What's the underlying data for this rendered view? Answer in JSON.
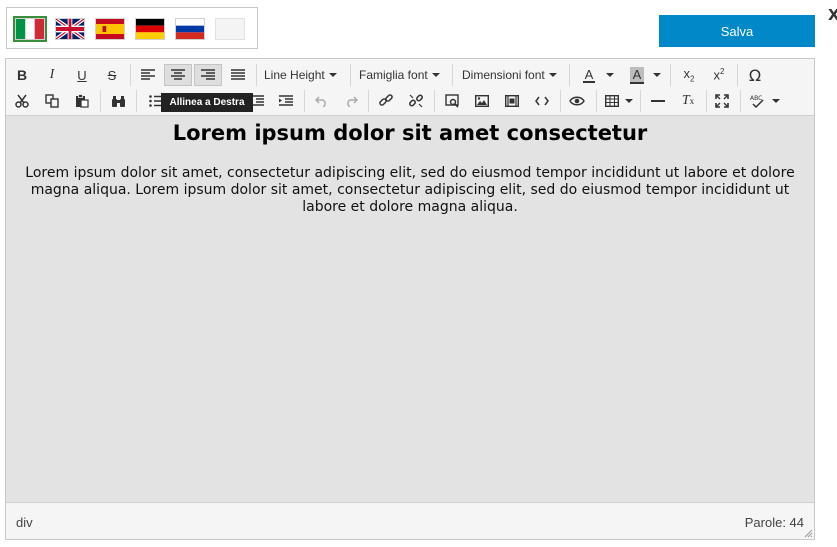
{
  "languages": [
    {
      "name": "italian",
      "selected": true
    },
    {
      "name": "english",
      "selected": false
    },
    {
      "name": "spanish",
      "selected": false
    },
    {
      "name": "german",
      "selected": false
    },
    {
      "name": "russian",
      "selected": false
    },
    {
      "name": "empty",
      "selected": false
    }
  ],
  "actions": {
    "save_label": "Salva",
    "close_label": "X"
  },
  "toolbar": {
    "line_height_label": "Line Height",
    "font_family_label": "Famiglia font",
    "font_size_label": "Dimensioni font",
    "font_color_glyph": "A",
    "bg_color_glyph": "A",
    "tooltip": "Allinea a Destra"
  },
  "content": {
    "heading": "Lorem ipsum dolor sit amet consectetur",
    "paragraph": "Lorem ipsum dolor sit amet, consectetur adipiscing elit, sed do eiusmod tempor incididunt ut labore et dolore magna aliqua. Lorem ipsum dolor sit amet, consectetur adipiscing elit, sed do eiusmod tempor incididunt ut labore et dolore magna aliqua."
  },
  "status": {
    "path": "div",
    "word_count": "Parole: 44"
  },
  "colors": {
    "save_button": "#0088c8",
    "editor_bg": "#e3e3e3",
    "toolbar_bg": "#f5f5f5"
  }
}
